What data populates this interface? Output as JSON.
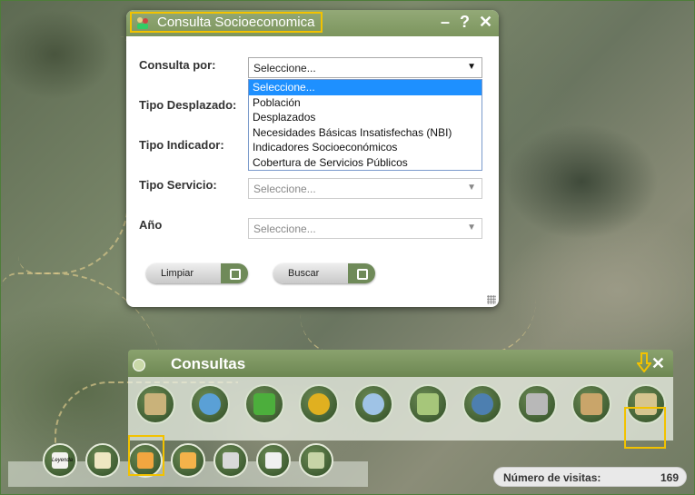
{
  "dialog": {
    "title": "Consulta Socioeconomica",
    "minimize": "–",
    "help": "?",
    "close": "✕",
    "fields": [
      {
        "label": "Consulta por:",
        "value": "Seleccione...",
        "active": true
      },
      {
        "label": "Tipo Desplazado:",
        "value": "",
        "active": false
      },
      {
        "label": "Tipo Indicador:",
        "value": "",
        "active": false
      },
      {
        "label": "Tipo Servicio:",
        "value": "Seleccione...",
        "active": false
      },
      {
        "label": "Año",
        "value": "Seleccione...",
        "active": false
      }
    ],
    "dropdown_options": [
      "Seleccione...",
      "Población",
      "Desplazados",
      "Necesidades Básicas Insatisfechas (NBI)",
      "Indicadores Socioeconómicos",
      "Cobertura de Servicios Públicos"
    ],
    "buttons": {
      "clear": "Limpiar",
      "search": "Buscar"
    }
  },
  "consultas_panel": {
    "title": "Consultas",
    "close": "✕",
    "icons": [
      "map-query-icon",
      "search-globe-icon",
      "flora-fauna-icon",
      "culture-masks-icon",
      "health-doctor-icon",
      "zoom-land-icon",
      "hydrology-icon",
      "industry-icon",
      "housing-icon",
      "socioeconomic-people-icon"
    ]
  },
  "toolbar": {
    "icons": [
      "legend-icon",
      "layers-icon",
      "folder-open-icon",
      "folder-icon",
      "print-icon",
      "measure-icon",
      "map-overview-icon"
    ],
    "legend_text": "Leyenda"
  },
  "visits": {
    "label": "Número de visitas:",
    "value": "169"
  },
  "colors": {
    "header": "#7c955e",
    "highlight": "#f2c200",
    "selection": "#1e90ff"
  }
}
